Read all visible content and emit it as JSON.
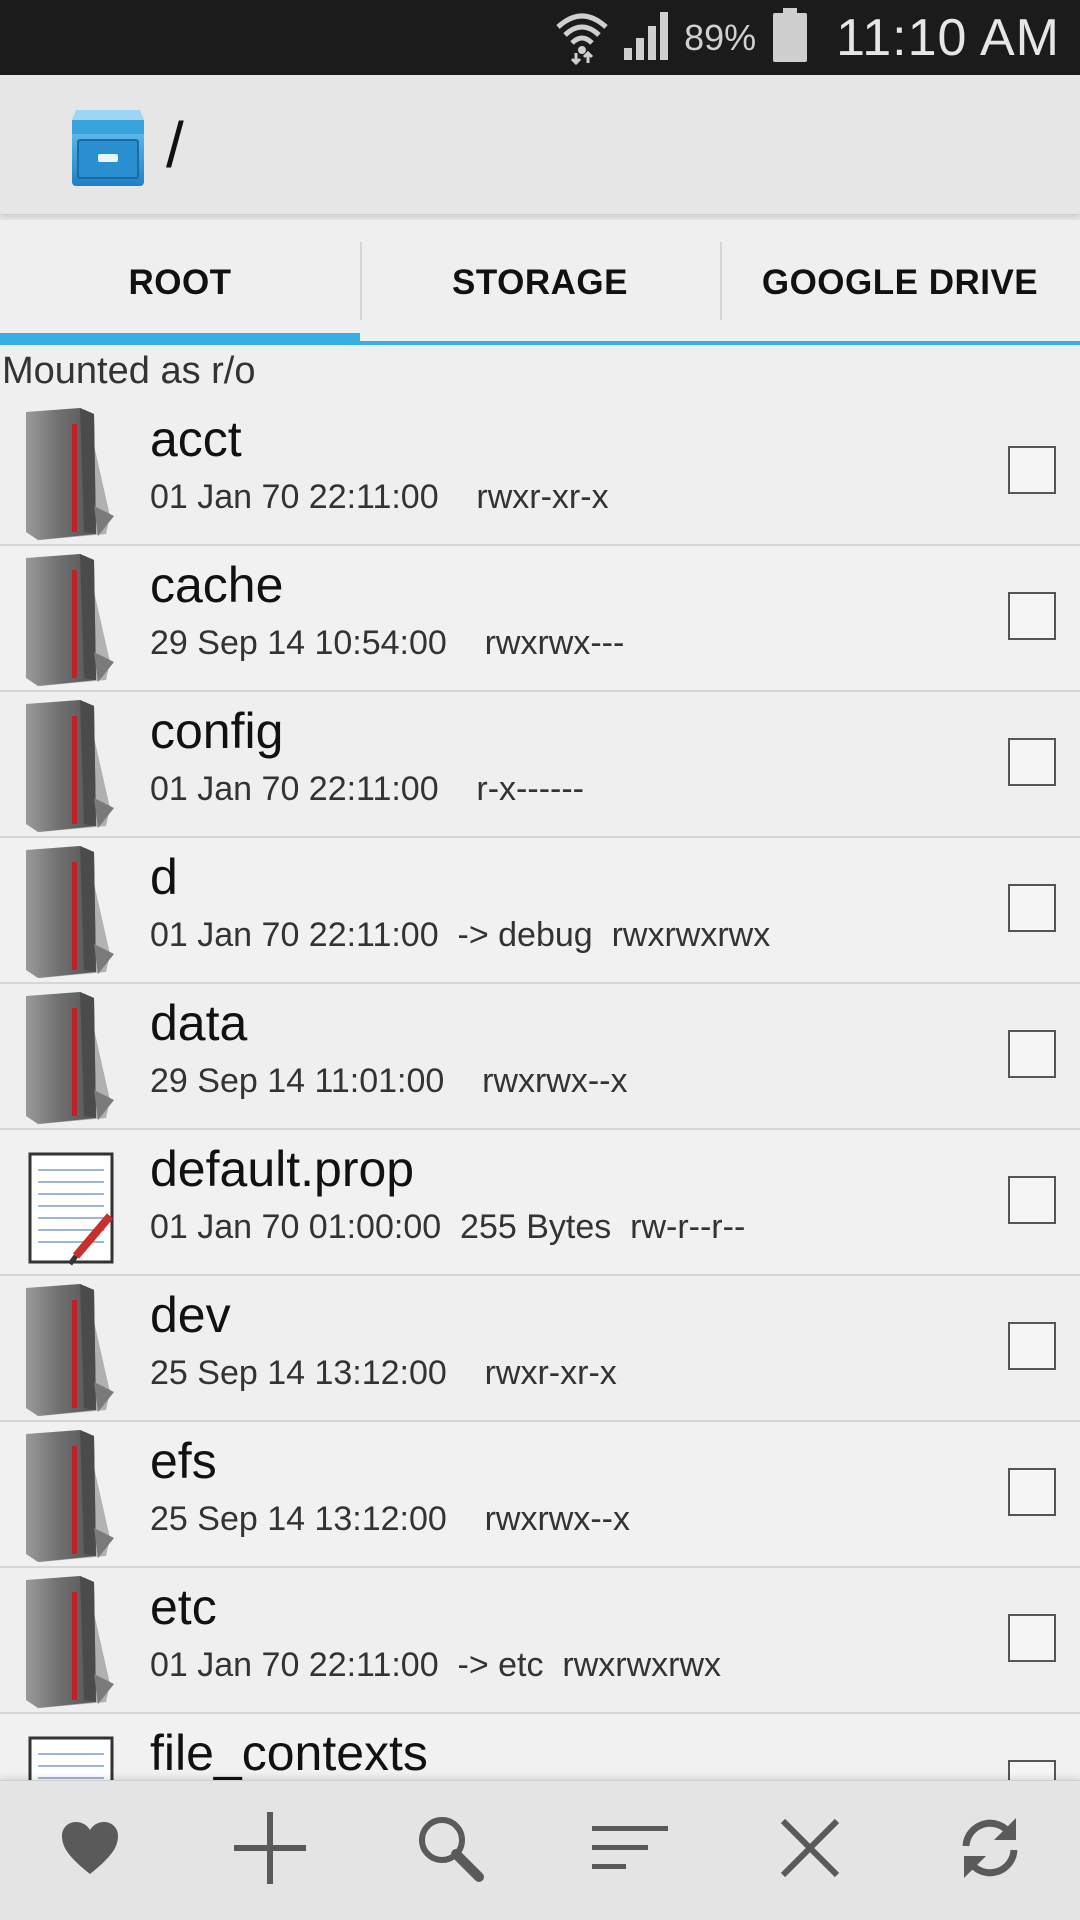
{
  "status_bar": {
    "battery_percent": "89%",
    "time": "11:10 AM",
    "icons": [
      "wifi-icon",
      "signal-icon",
      "battery-icon"
    ]
  },
  "action_bar": {
    "title": "/",
    "logo_icon": "file-cabinet-icon"
  },
  "tabs": [
    {
      "label": "ROOT",
      "active": true
    },
    {
      "label": "STORAGE",
      "active": false
    },
    {
      "label": "GOOGLE DRIVE",
      "active": false
    }
  ],
  "mount_status": "Mounted as r/o",
  "files": [
    {
      "name": "acct",
      "meta": "01 Jan 70 22:11:00    rwxr-xr-x",
      "type": "folder"
    },
    {
      "name": "cache",
      "meta": "29 Sep 14 10:54:00    rwxrwx---",
      "type": "folder"
    },
    {
      "name": "config",
      "meta": "01 Jan 70 22:11:00    r-x------",
      "type": "folder"
    },
    {
      "name": "d",
      "meta": "01 Jan 70 22:11:00  -> debug  rwxrwxrwx",
      "type": "folder"
    },
    {
      "name": "data",
      "meta": "29 Sep 14 11:01:00    rwxrwx--x",
      "type": "folder"
    },
    {
      "name": "default.prop",
      "meta": "01 Jan 70 01:00:00  255 Bytes  rw-r--r--",
      "type": "file"
    },
    {
      "name": "dev",
      "meta": "25 Sep 14 13:12:00    rwxr-xr-x",
      "type": "folder"
    },
    {
      "name": "efs",
      "meta": "25 Sep 14 13:12:00    rwxrwx--x",
      "type": "folder"
    },
    {
      "name": "etc",
      "meta": "01 Jan 70 22:11:00  -> etc  rwxrwxrwx",
      "type": "folder"
    },
    {
      "name": "file_contexts",
      "meta": "",
      "type": "file"
    }
  ],
  "toolbar": {
    "buttons": [
      "heart-icon",
      "plus-icon",
      "search-icon",
      "sort-icon",
      "close-icon",
      "refresh-icon"
    ]
  },
  "colors": {
    "accent": "#36aee2",
    "folder_stripe": "#c0202a",
    "status_bar_bg": "#1b1b1b"
  }
}
